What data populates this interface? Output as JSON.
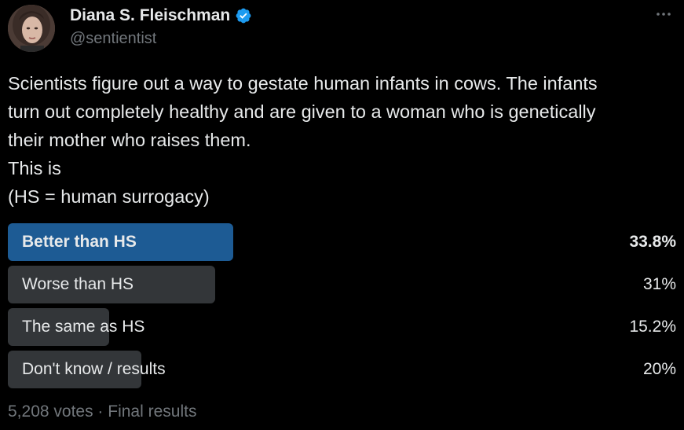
{
  "author": {
    "display_name": "Diana S. Fleischman",
    "handle": "@sentientist",
    "verified": true
  },
  "icons": {
    "verified": "verified-badge-icon",
    "more": "more-horizontal-icon"
  },
  "colors": {
    "verified_badge": "#1d9bf0",
    "winner_bar": "#1d5b94",
    "bar": "#333639",
    "text": "#e7e9ea",
    "muted": "#71767b"
  },
  "tweet": {
    "lines": [
      "Scientists figure out a way to gestate human infants in cows. The infants",
      "turn out completely healthy and are given to a woman who is genetically",
      "their mother who raises them.",
      "This is",
      "(HS = human surrogacy)"
    ]
  },
  "poll": {
    "options": [
      {
        "label": "Better than HS",
        "percent_text": "33.8%",
        "percent": 33.8,
        "winner": true
      },
      {
        "label": "Worse than HS",
        "percent_text": "31%",
        "percent": 31,
        "winner": false
      },
      {
        "label": "The same as HS",
        "percent_text": "15.2%",
        "percent": 15.2,
        "winner": false
      },
      {
        "label": "Don't know / results",
        "percent_text": "20%",
        "percent": 20,
        "winner": false
      }
    ],
    "footer": "5,208 votes · Final results"
  }
}
